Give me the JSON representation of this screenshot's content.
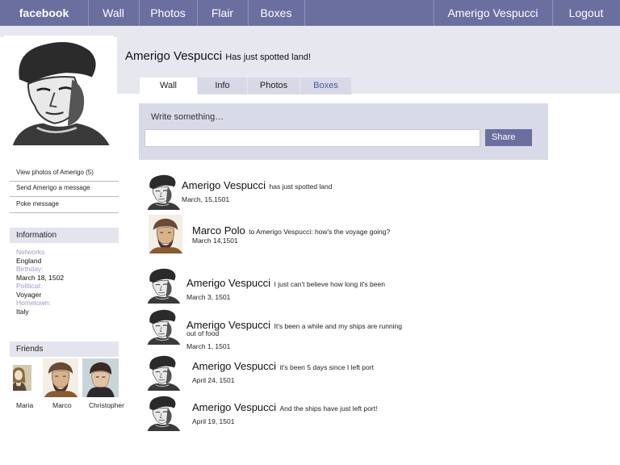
{
  "nav": {
    "logo": "facebook",
    "items": [
      "Wall",
      "Photos",
      "Flair",
      "Boxes"
    ],
    "user": "Amerigo Vespucci",
    "logout": "Logout"
  },
  "profile": {
    "name": "Amerigo Vespucci",
    "status": "Has just spotted land!"
  },
  "tabs": [
    "Wall",
    "Info",
    "Photos",
    "Boxes"
  ],
  "composer": {
    "label": "Write something…",
    "value": "",
    "share": "Share"
  },
  "sidebar": {
    "links": [
      "View photos of Amerigo (5)",
      "Send Amerigo a message",
      "Poke message"
    ],
    "information": {
      "title": "Information",
      "fields": [
        {
          "label": "Networks",
          "value": "England"
        },
        {
          "label": "Birthday:",
          "value": "March 18, 1502"
        },
        {
          "label": "Political:",
          "value": "Voyager"
        },
        {
          "label": "Hometown:",
          "value": "Italy"
        }
      ]
    },
    "friends": {
      "title": "Friends",
      "names": [
        "Maria",
        "Marco",
        "Christopher"
      ]
    }
  },
  "feed": [
    {
      "author": "Amerigo Vespucci",
      "text": "has just spotted land",
      "date": "March, 15,1501"
    },
    {
      "author": "Marco Polo",
      "text": "to Amerigo Vespucci: how's the voyage going?",
      "date": "March 14,1501"
    },
    {
      "author": "Amerigo Vespucci",
      "text": "I just can't believe how long it's been",
      "date": "March 3, 1501"
    },
    {
      "author": "Amerigo Vespucci",
      "text": "It's been a while and my ships are running",
      "text2": "out of food",
      "date": "March 1, 1501"
    },
    {
      "author": "Amerigo Vespucci",
      "text": "it's been 5 days since I left port",
      "date": "April 24, 1501"
    },
    {
      "author": "Amerigo Vespucci",
      "text": "And the ships have just left port!",
      "date": "April 19, 1501"
    }
  ],
  "colors": {
    "topbar": "#6b6fa0",
    "band": "#e6e7ef",
    "composer": "#d9dae7",
    "label": "#9a9cc0"
  }
}
